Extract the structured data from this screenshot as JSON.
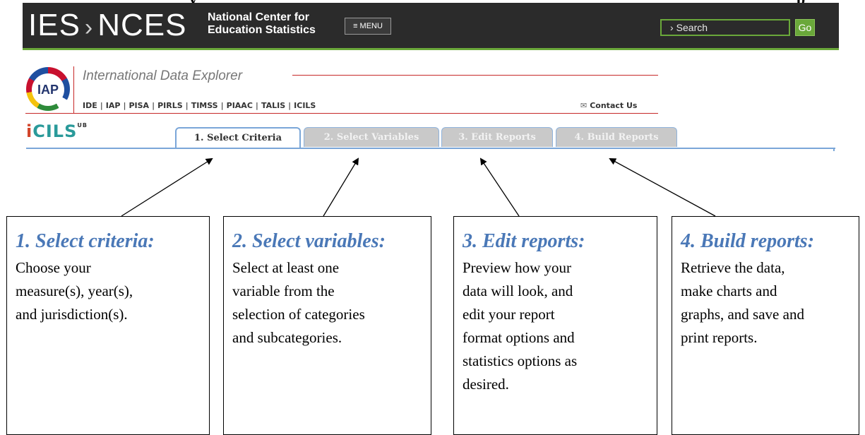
{
  "top_clip": {
    "left": "y",
    "right": "p"
  },
  "nces": {
    "logo_left": "IES",
    "logo_sep": "›",
    "logo_right": "NCES",
    "name_line1": "National Center for",
    "name_line2": "Education Statistics",
    "menu_label": "≡ MENU",
    "search_placeholder": "Search",
    "go_label": "Go"
  },
  "ide": {
    "logo_text": "IAP",
    "title": "International Data Explorer",
    "nav": [
      "IDE",
      "IAP",
      "PISA",
      "PIRLS",
      "TIMSS",
      "PIAAC",
      "TALIS",
      "ICILS"
    ],
    "contact": "Contact Us"
  },
  "cils": {
    "logo_i": "i",
    "logo_rest": "CILS",
    "logo_sup": "UB"
  },
  "tabs": [
    {
      "label": "1. Select Criteria",
      "active": true
    },
    {
      "label": "2. Select Variables",
      "active": false
    },
    {
      "label": "3. Edit Reports",
      "active": false
    },
    {
      "label": "4. Build Reports",
      "active": false
    }
  ],
  "boxes": [
    {
      "title": "1. Select criteria:",
      "lines": [
        "Choose your",
        "measure(s), year(s),",
        "and jurisdiction(s)."
      ]
    },
    {
      "title": "2. Select variables:",
      "lines": [
        "Select at least one",
        "variable from the",
        "selection of categories",
        "and subcategories."
      ]
    },
    {
      "title": "3. Edit reports:",
      "lines": [
        "Preview how your",
        "data will look, and",
        "edit your report",
        "format options and",
        "statistics options as",
        "desired."
      ]
    },
    {
      "title": "4. Build reports:",
      "lines": [
        "Retrieve the data,",
        "make charts and",
        "graphs, and save and",
        "print reports."
      ]
    }
  ],
  "colors": {
    "bar": "#2b2b2b",
    "green": "#6aa83a",
    "ide_red": "#c62828",
    "tab_blue": "#7aa6d8",
    "box_title": "#4a78b7"
  }
}
